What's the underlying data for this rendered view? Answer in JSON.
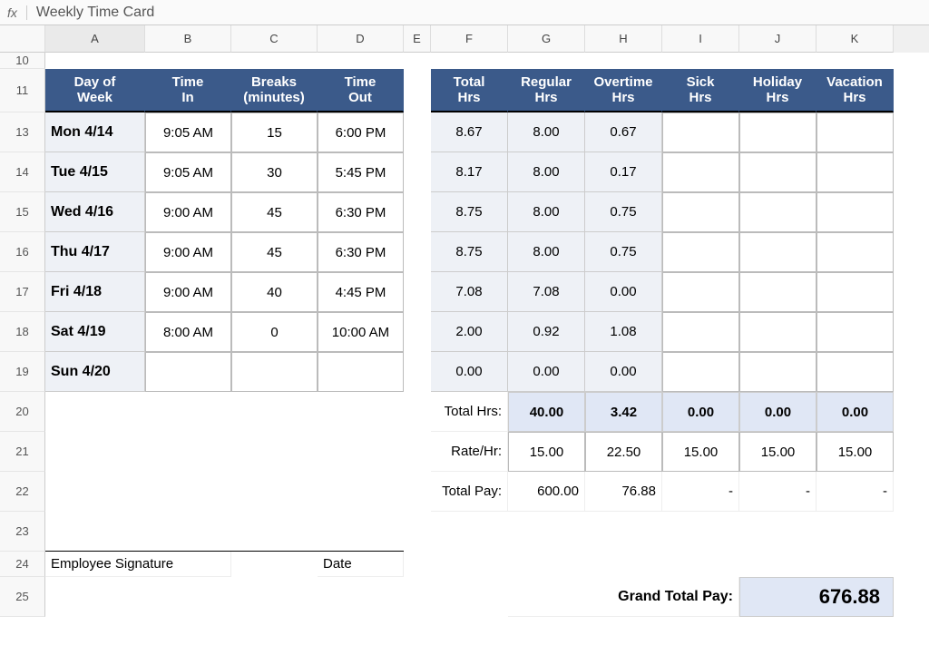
{
  "formula_bar": {
    "fx": "fx",
    "value": "Weekly Time Card"
  },
  "columns": [
    "",
    "A",
    "B",
    "C",
    "D",
    "E",
    "F",
    "G",
    "H",
    "I",
    "J",
    "K"
  ],
  "row_labels": [
    "10",
    "11",
    "13",
    "14",
    "15",
    "16",
    "17",
    "18",
    "19",
    "20",
    "21",
    "22",
    "23",
    "24",
    "25"
  ],
  "headers_left": [
    "Day of\nWeek",
    "Time\nIn",
    "Breaks\n(minutes)",
    "Time\nOut"
  ],
  "headers_right": [
    "Total\nHrs",
    "Regular\nHrs",
    "Overtime\nHrs",
    "Sick\nHrs",
    "Holiday\nHrs",
    "Vacation\nHrs"
  ],
  "days": [
    {
      "day": "Mon 4/14",
      "in": "9:05 AM",
      "breaks": "15",
      "out": "6:00 PM",
      "total": "8.67",
      "reg": "8.00",
      "ot": "0.67",
      "sick": "",
      "hol": "",
      "vac": ""
    },
    {
      "day": "Tue 4/15",
      "in": "9:05 AM",
      "breaks": "30",
      "out": "5:45 PM",
      "total": "8.17",
      "reg": "8.00",
      "ot": "0.17",
      "sick": "",
      "hol": "",
      "vac": ""
    },
    {
      "day": "Wed 4/16",
      "in": "9:00 AM",
      "breaks": "45",
      "out": "6:30 PM",
      "total": "8.75",
      "reg": "8.00",
      "ot": "0.75",
      "sick": "",
      "hol": "",
      "vac": ""
    },
    {
      "day": "Thu 4/17",
      "in": "9:00 AM",
      "breaks": "45",
      "out": "6:30 PM",
      "total": "8.75",
      "reg": "8.00",
      "ot": "0.75",
      "sick": "",
      "hol": "",
      "vac": ""
    },
    {
      "day": "Fri 4/18",
      "in": "9:00 AM",
      "breaks": "40",
      "out": "4:45 PM",
      "total": "7.08",
      "reg": "7.08",
      "ot": "0.00",
      "sick": "",
      "hol": "",
      "vac": ""
    },
    {
      "day": "Sat 4/19",
      "in": "8:00 AM",
      "breaks": "0",
      "out": "10:00 AM",
      "total": "2.00",
      "reg": "0.92",
      "ot": "1.08",
      "sick": "",
      "hol": "",
      "vac": ""
    },
    {
      "day": "Sun 4/20",
      "in": "",
      "breaks": "",
      "out": "",
      "total": "0.00",
      "reg": "0.00",
      "ot": "0.00",
      "sick": "",
      "hol": "",
      "vac": ""
    }
  ],
  "totals_label": "Total Hrs:",
  "totals": [
    "40.00",
    "3.42",
    "0.00",
    "0.00",
    "0.00"
  ],
  "rate_label": "Rate/Hr:",
  "rates": [
    "15.00",
    "22.50",
    "15.00",
    "15.00",
    "15.00"
  ],
  "pay_label": "Total Pay:",
  "pays": [
    "600.00",
    "76.88",
    "-",
    "-",
    "-"
  ],
  "sig": "Employee Signature",
  "date": "Date",
  "grand_label": "Grand Total Pay:",
  "grand_value": "676.88"
}
